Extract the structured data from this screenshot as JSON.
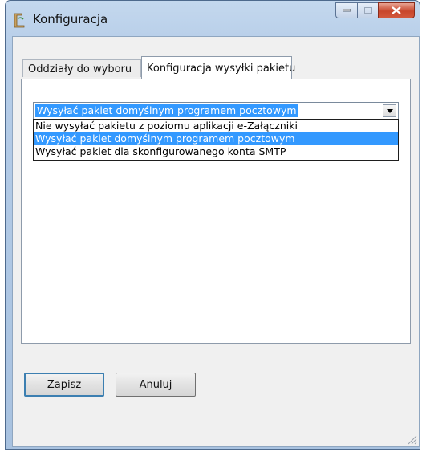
{
  "window": {
    "title": "Konfiguracja",
    "colors": {
      "frame": "#b6cde8",
      "close": "#c8462c",
      "selection": "#3399ff"
    }
  },
  "tabs": [
    {
      "label": "Oddziały do wyboru",
      "active": false
    },
    {
      "label": "Konfiguracja wysyłki pakietu",
      "active": true
    }
  ],
  "send_option": {
    "selected": "Wysyłać pakiet domyślnym programem pocztowym",
    "options": [
      "Nie wysyłać pakietu z poziomu aplikacji e-Załączniki",
      "Wysyłać pakiet domyślnym programem pocztowym",
      "Wysyłać pakiet dla skonfigurowanego konta SMTP"
    ]
  },
  "buttons": {
    "save": "Zapisz",
    "cancel": "Anuluj"
  },
  "icons": {
    "app": "app-icon",
    "minimize": "minimize-icon",
    "maximize": "maximize-icon",
    "close": "close-icon",
    "dropdown": "chevron-down-icon",
    "resize": "resize-grip-icon"
  }
}
